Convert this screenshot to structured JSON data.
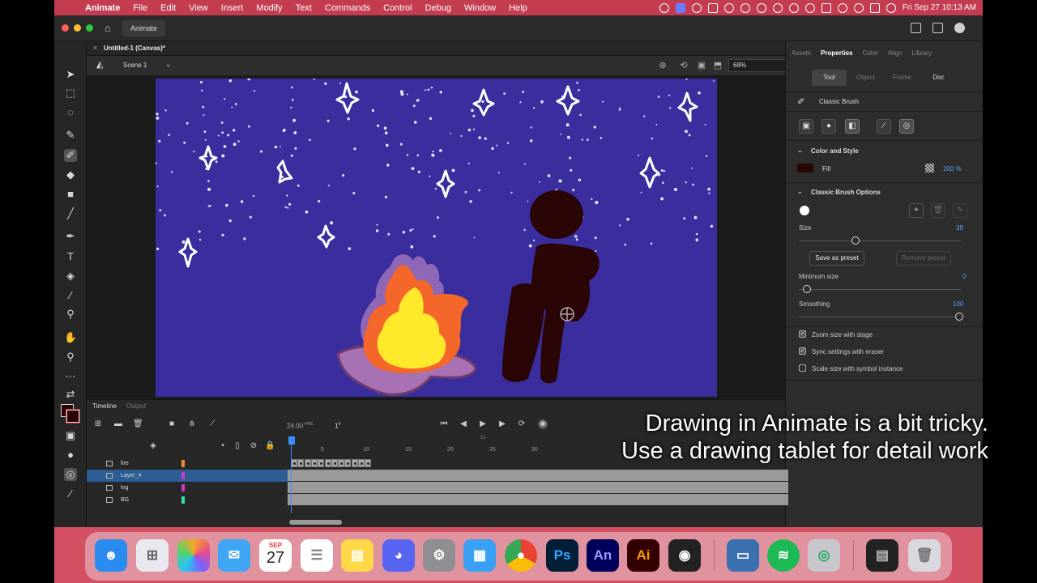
{
  "menubar": {
    "apple": "",
    "items": [
      "Animate",
      "File",
      "Edit",
      "View",
      "Insert",
      "Modify",
      "Text",
      "Commands",
      "Control",
      "Debug",
      "Window",
      "Help"
    ],
    "clock": "Fri Sep 27  10:13 AM"
  },
  "window": {
    "app_tab": "Animate",
    "doc_tab": "Untitled-1 (Canvas)*"
  },
  "scene": {
    "label": "Scene 1",
    "zoom": "68%"
  },
  "panel": {
    "tabs": [
      "Assets",
      "Properties",
      "Color",
      "Align",
      "Library"
    ],
    "active_tab": "Properties",
    "subtabs": [
      "Tool",
      "Object",
      "Frame",
      "Doc"
    ],
    "tool_name": "Classic Brush",
    "color_section": "Color and Style",
    "fill_label": "Fill",
    "fill_color": "#2a0505",
    "fill_alpha": "100 %",
    "brush_section": "Classic Brush Options",
    "size_label": "Size",
    "size_value": "39",
    "size_level": 0.35,
    "save_preset": "Save as preset",
    "remove_preset": "Remove preset",
    "min_size_label": "Minimum size",
    "min_size_value": "0",
    "smoothing_label": "Smoothing",
    "smoothing_value": "100",
    "opt_zoom": "Zoom size with stage",
    "opt_sync": "Sync settings with eraser",
    "opt_scale": "Scale size with symbol instance",
    "opt_zoom_checked": true,
    "opt_sync_checked": true,
    "opt_scale_checked": false
  },
  "timeline": {
    "tabs": [
      "Timeline",
      "Output"
    ],
    "fps": "24.00",
    "fps_unit": "FPS",
    "frame": "1",
    "frame_unit": "F",
    "ruler": [
      "5",
      "10",
      "15",
      "20",
      "25",
      "30"
    ],
    "ruler_seconds": "1s",
    "layers": [
      {
        "name": "fire",
        "color": "#f08a2a"
      },
      {
        "name": "Layer_4",
        "color": "#c53cc8"
      },
      {
        "name": "log",
        "color": "#c53cc8"
      },
      {
        "name": "BG",
        "color": "#39e0b0"
      }
    ],
    "selected_layer": "Layer_4"
  },
  "dock": {
    "calendar_month": "SEP",
    "calendar_day": "27",
    "ps": "Ps",
    "an": "An",
    "ai": "Ai"
  },
  "caption": {
    "line1": "Drawing in Animate is a bit tricky.",
    "line2": "Use a drawing tablet for detail work"
  },
  "colors": {
    "menubar": "#c43c4f",
    "canvas": "#3a2e9e",
    "figure": "#2a0505",
    "flame_outer": "#f4662a",
    "flame_inner": "#ffe92a",
    "log": "#a871b4",
    "accent": "#3a8eff"
  }
}
